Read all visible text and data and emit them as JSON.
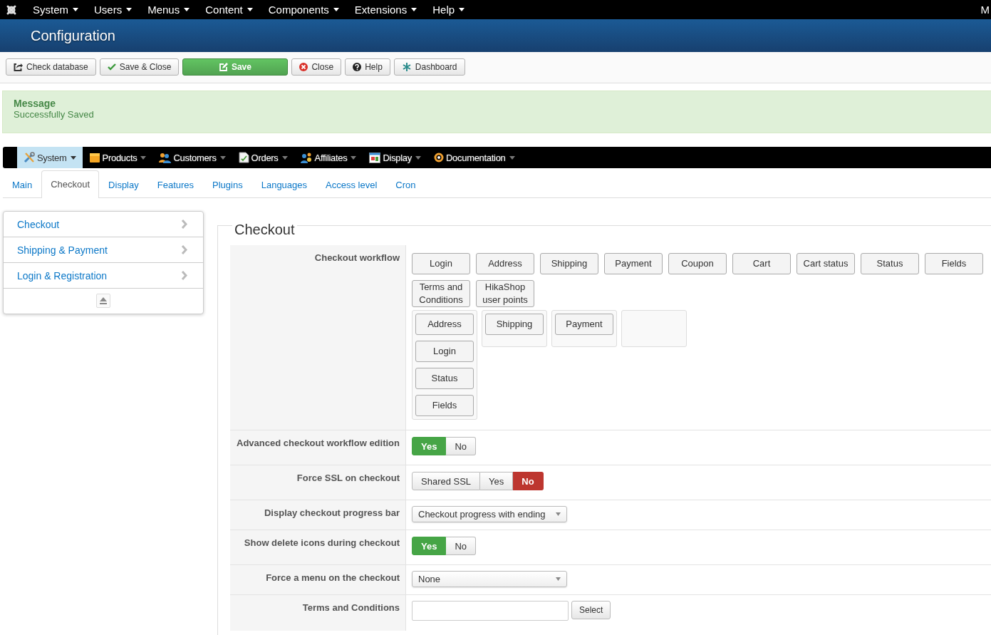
{
  "top_menu": {
    "items": [
      "System",
      "Users",
      "Menus",
      "Content",
      "Components",
      "Extensions",
      "Help"
    ],
    "edge_text": "M"
  },
  "page_title": "Configuration",
  "toolbar": [
    {
      "label": "Check database",
      "kind": "check"
    },
    {
      "label": "Save & Close",
      "kind": "save-close"
    },
    {
      "label": "Save",
      "kind": "save"
    },
    {
      "label": "Close",
      "kind": "close"
    },
    {
      "label": "Help",
      "kind": "help"
    },
    {
      "label": "Dashboard",
      "kind": "dashboard"
    }
  ],
  "message": {
    "heading": "Message",
    "text": "Successfully Saved"
  },
  "shop_menu": [
    {
      "label": "System",
      "kind": "tools",
      "selected": true
    },
    {
      "label": "Products",
      "kind": "box",
      "selected": false
    },
    {
      "label": "Customers",
      "kind": "users",
      "selected": false
    },
    {
      "label": "Orders",
      "kind": "document",
      "selected": false
    },
    {
      "label": "Affiliates",
      "kind": "affiliates",
      "selected": false
    },
    {
      "label": "Display",
      "kind": "window",
      "selected": false
    },
    {
      "label": "Documentation",
      "kind": "lifebuoy",
      "selected": false
    }
  ],
  "tabs": [
    {
      "label": "Main",
      "selected": false
    },
    {
      "label": "Checkout",
      "selected": true
    },
    {
      "label": "Display",
      "selected": false
    },
    {
      "label": "Features",
      "selected": false
    },
    {
      "label": "Plugins",
      "selected": false
    },
    {
      "label": "Languages",
      "selected": false
    },
    {
      "label": "Access level",
      "selected": false
    },
    {
      "label": "Cron",
      "selected": false
    }
  ],
  "sidebar": {
    "items": [
      "Checkout",
      "Shipping & Payment",
      "Login & Registration"
    ]
  },
  "section": {
    "legend": "Checkout",
    "workflow": {
      "label": "Checkout workflow",
      "available": [
        "Login",
        "Address",
        "Shipping",
        "Payment",
        "Coupon",
        "Cart",
        "Cart status",
        "Status",
        "Fields",
        "Terms and Conditions",
        "HikaShop user points"
      ],
      "steps": [
        {
          "kind": "group",
          "items": [
            "Address",
            "Login",
            "Status",
            "Fields"
          ]
        },
        {
          "kind": "group",
          "items": [
            "Shipping"
          ]
        },
        {
          "kind": "group",
          "items": [
            "Payment"
          ]
        },
        {
          "kind": "empty"
        }
      ]
    },
    "settings": [
      {
        "label": "Advanced checkout workflow edition",
        "kind": "toggle",
        "options": [
          {
            "label": "Yes",
            "selected": true,
            "color": "#46a546"
          },
          {
            "label": "No",
            "selected": false
          }
        ]
      },
      {
        "label": "Force SSL on checkout",
        "kind": "toggle",
        "options": [
          {
            "label": "Shared SSL",
            "selected": false
          },
          {
            "label": "Yes",
            "selected": false
          },
          {
            "label": "No",
            "selected": true,
            "color": "#bd362f"
          }
        ]
      },
      {
        "label": "Display checkout progress bar",
        "kind": "select",
        "value": "Checkout progress with ending"
      },
      {
        "label": "Show delete icons during checkout",
        "kind": "toggle",
        "options": [
          {
            "label": "Yes",
            "selected": true,
            "color": "#46a546"
          },
          {
            "label": "No",
            "selected": false
          }
        ]
      },
      {
        "label": "Force a menu on the checkout",
        "kind": "select",
        "value": "None"
      },
      {
        "label": "Terms and Conditions",
        "kind": "picker",
        "button": "Select"
      }
    ]
  }
}
